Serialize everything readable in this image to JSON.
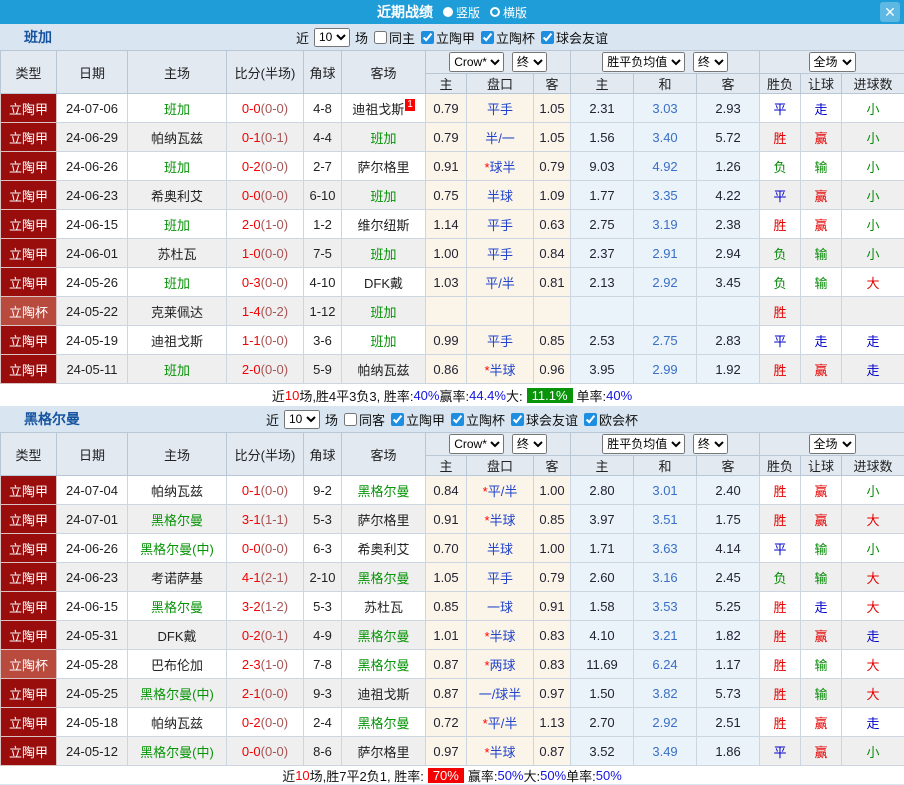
{
  "titlebar": {
    "title": "近期战绩",
    "vertical_label": "竖版",
    "horizontal_label": "横版",
    "vertical_selected": true,
    "close": "✕"
  },
  "colors": {
    "topbar": "#1f9dd9",
    "league_red": "#9a0d0d",
    "cup_red": "#b94a3e",
    "win_red": "#e60000",
    "draw_blue": "#0000cc",
    "lose_green": "#088a08",
    "odds_bg": "#fbf4e8",
    "avg_bg": "#eaf3fa"
  },
  "table_header": {
    "cols": [
      "类型",
      "日期",
      "主场",
      "比分(半场)",
      "角球",
      "客场"
    ],
    "dd_company": "Crow*",
    "dd_final": "终",
    "dd_avg": "胜平负均值",
    "dd_scope": "全场",
    "sub": [
      "主",
      "盘口",
      "客",
      "主",
      "和",
      "客",
      "胜负",
      "让球",
      "进球数"
    ]
  },
  "sections": [
    {
      "team": "班加",
      "filters": {
        "near": "近",
        "count": "10",
        "games": "场",
        "checks": [
          {
            "label": "同主",
            "on": false
          },
          {
            "label": "立陶甲",
            "on": true
          },
          {
            "label": "立陶杯",
            "on": true
          },
          {
            "label": "球会友谊",
            "on": true
          }
        ]
      },
      "rows": [
        {
          "lg": "立陶甲",
          "cup": false,
          "date": "24-07-06",
          "home": "班加",
          "hs": true,
          "score": "0-0",
          "half": "(0-0)",
          "corner": "4-8",
          "away": "迪祖戈斯",
          "as": false,
          "badge": "1",
          "o": [
            "0.79",
            "平手",
            "1.05"
          ],
          "avg": [
            "2.31",
            "3.03",
            "2.93"
          ],
          "r": [
            "平",
            "走",
            "小"
          ]
        },
        {
          "lg": "立陶甲",
          "cup": false,
          "date": "24-06-29",
          "home": "帕纳瓦兹",
          "hs": false,
          "score": "0-1",
          "half": "(0-1)",
          "corner": "4-4",
          "away": "班加",
          "as": true,
          "badge": "",
          "o": [
            "0.79",
            "半/一",
            "1.05"
          ],
          "avg": [
            "1.56",
            "3.40",
            "5.72"
          ],
          "r": [
            "胜",
            "赢",
            "小"
          ]
        },
        {
          "lg": "立陶甲",
          "cup": false,
          "date": "24-06-26",
          "home": "班加",
          "hs": true,
          "score": "0-2",
          "half": "(0-0)",
          "corner": "2-7",
          "away": "萨尔格里",
          "as": false,
          "badge": "",
          "o": [
            "0.91",
            "*球半",
            "0.79"
          ],
          "avg": [
            "9.03",
            "4.92",
            "1.26"
          ],
          "r": [
            "负",
            "输",
            "小"
          ]
        },
        {
          "lg": "立陶甲",
          "cup": false,
          "date": "24-06-23",
          "home": "希奥利艾",
          "hs": false,
          "score": "0-0",
          "half": "(0-0)",
          "corner": "6-10",
          "away": "班加",
          "as": true,
          "badge": "",
          "o": [
            "0.75",
            "半球",
            "1.09"
          ],
          "avg": [
            "1.77",
            "3.35",
            "4.22"
          ],
          "r": [
            "平",
            "赢",
            "小"
          ]
        },
        {
          "lg": "立陶甲",
          "cup": false,
          "date": "24-06-15",
          "home": "班加",
          "hs": true,
          "score": "2-0",
          "half": "(1-0)",
          "corner": "1-2",
          "away": "维尔纽斯",
          "as": false,
          "badge": "",
          "o": [
            "1.14",
            "平手",
            "0.63"
          ],
          "avg": [
            "2.75",
            "3.19",
            "2.38"
          ],
          "r": [
            "胜",
            "赢",
            "小"
          ]
        },
        {
          "lg": "立陶甲",
          "cup": false,
          "date": "24-06-01",
          "home": "苏杜瓦",
          "hs": false,
          "score": "1-0",
          "half": "(0-0)",
          "corner": "7-5",
          "away": "班加",
          "as": true,
          "badge": "",
          "o": [
            "1.00",
            "平手",
            "0.84"
          ],
          "avg": [
            "2.37",
            "2.91",
            "2.94"
          ],
          "r": [
            "负",
            "输",
            "小"
          ]
        },
        {
          "lg": "立陶甲",
          "cup": false,
          "date": "24-05-26",
          "home": "班加",
          "hs": true,
          "score": "0-3",
          "half": "(0-0)",
          "corner": "4-10",
          "away": "DFK戴",
          "as": false,
          "badge": "",
          "o": [
            "1.03",
            "平/半",
            "0.81"
          ],
          "avg": [
            "2.13",
            "2.92",
            "3.45"
          ],
          "r": [
            "负",
            "输",
            "大"
          ]
        },
        {
          "lg": "立陶杯",
          "cup": true,
          "date": "24-05-22",
          "home": "克莱佩达",
          "hs": false,
          "score": "1-4",
          "half": "(0-2)",
          "corner": "1-12",
          "away": "班加",
          "as": true,
          "badge": "",
          "o": [
            "",
            "",
            ""
          ],
          "avg": [
            "",
            "",
            ""
          ],
          "r": [
            "胜",
            "",
            ""
          ]
        },
        {
          "lg": "立陶甲",
          "cup": false,
          "date": "24-05-19",
          "home": "迪祖戈斯",
          "hs": false,
          "score": "1-1",
          "half": "(0-0)",
          "corner": "3-6",
          "away": "班加",
          "as": true,
          "badge": "",
          "o": [
            "0.99",
            "平手",
            "0.85"
          ],
          "avg": [
            "2.53",
            "2.75",
            "2.83"
          ],
          "r": [
            "平",
            "走",
            "走"
          ]
        },
        {
          "lg": "立陶甲",
          "cup": false,
          "date": "24-05-11",
          "home": "班加",
          "hs": true,
          "score": "2-0",
          "half": "(0-0)",
          "corner": "5-9",
          "away": "帕纳瓦兹",
          "as": false,
          "badge": "",
          "o": [
            "0.86",
            "*半球",
            "0.96"
          ],
          "avg": [
            "3.95",
            "2.99",
            "1.92"
          ],
          "r": [
            "胜",
            "赢",
            "走"
          ]
        }
      ],
      "summary": [
        {
          "t": "近",
          "s": "plain"
        },
        {
          "t": "10",
          "s": "red"
        },
        {
          "t": "场,胜4平3负3, 胜率:",
          "s": "plain"
        },
        {
          "t": "40%",
          "s": "blue"
        },
        {
          "t": " 赢率:",
          "s": "plain"
        },
        {
          "t": "44.4%",
          "s": "blue"
        },
        {
          "t": " 大:",
          "s": "plain"
        },
        {
          "t": "11.1%",
          "s": "greenbox"
        },
        {
          "t": " 单率:",
          "s": "plain"
        },
        {
          "t": "40%",
          "s": "blue"
        }
      ]
    },
    {
      "team": "黑格尔曼",
      "filters": {
        "near": "近",
        "count": "10",
        "games": "场",
        "checks": [
          {
            "label": "同客",
            "on": false
          },
          {
            "label": "立陶甲",
            "on": true
          },
          {
            "label": "立陶杯",
            "on": true
          },
          {
            "label": "球会友谊",
            "on": true
          },
          {
            "label": "欧会杯",
            "on": true
          }
        ]
      },
      "rows": [
        {
          "lg": "立陶甲",
          "cup": false,
          "date": "24-07-04",
          "home": "帕纳瓦兹",
          "hs": false,
          "score": "0-1",
          "half": "(0-0)",
          "corner": "9-2",
          "away": "黑格尔曼",
          "as": true,
          "badge": "",
          "o": [
            "0.84",
            "*平/半",
            "1.00"
          ],
          "avg": [
            "2.80",
            "3.01",
            "2.40"
          ],
          "r": [
            "胜",
            "赢",
            "小"
          ]
        },
        {
          "lg": "立陶甲",
          "cup": false,
          "date": "24-07-01",
          "home": "黑格尔曼",
          "hs": true,
          "score": "3-1",
          "half": "(1-1)",
          "corner": "5-3",
          "away": "萨尔格里",
          "as": false,
          "badge": "",
          "o": [
            "0.91",
            "*半球",
            "0.85"
          ],
          "avg": [
            "3.97",
            "3.51",
            "1.75"
          ],
          "r": [
            "胜",
            "赢",
            "大"
          ]
        },
        {
          "lg": "立陶甲",
          "cup": false,
          "date": "24-06-26",
          "home": "黑格尔曼(中)",
          "hs": true,
          "score": "0-0",
          "half": "(0-0)",
          "corner": "6-3",
          "away": "希奥利艾",
          "as": false,
          "badge": "",
          "o": [
            "0.70",
            "半球",
            "1.00"
          ],
          "avg": [
            "1.71",
            "3.63",
            "4.14"
          ],
          "r": [
            "平",
            "输",
            "小"
          ]
        },
        {
          "lg": "立陶甲",
          "cup": false,
          "date": "24-06-23",
          "home": "考诺萨基",
          "hs": false,
          "score": "4-1",
          "half": "(2-1)",
          "corner": "2-10",
          "away": "黑格尔曼",
          "as": true,
          "badge": "",
          "o": [
            "1.05",
            "平手",
            "0.79"
          ],
          "avg": [
            "2.60",
            "3.16",
            "2.45"
          ],
          "r": [
            "负",
            "输",
            "大"
          ]
        },
        {
          "lg": "立陶甲",
          "cup": false,
          "date": "24-06-15",
          "home": "黑格尔曼",
          "hs": true,
          "score": "3-2",
          "half": "(1-2)",
          "corner": "5-3",
          "away": "苏杜瓦",
          "as": false,
          "badge": "",
          "o": [
            "0.85",
            "一球",
            "0.91"
          ],
          "avg": [
            "1.58",
            "3.53",
            "5.25"
          ],
          "r": [
            "胜",
            "走",
            "大"
          ]
        },
        {
          "lg": "立陶甲",
          "cup": false,
          "date": "24-05-31",
          "home": "DFK戴",
          "hs": false,
          "score": "0-2",
          "half": "(0-1)",
          "corner": "4-9",
          "away": "黑格尔曼",
          "as": true,
          "badge": "",
          "o": [
            "1.01",
            "*半球",
            "0.83"
          ],
          "avg": [
            "4.10",
            "3.21",
            "1.82"
          ],
          "r": [
            "胜",
            "赢",
            "走"
          ]
        },
        {
          "lg": "立陶杯",
          "cup": true,
          "date": "24-05-28",
          "home": "巴布伦加",
          "hs": false,
          "score": "2-3",
          "half": "(1-0)",
          "corner": "7-8",
          "away": "黑格尔曼",
          "as": true,
          "badge": "",
          "o": [
            "0.87",
            "*两球",
            "0.83"
          ],
          "avg": [
            "11.69",
            "6.24",
            "1.17"
          ],
          "r": [
            "胜",
            "输",
            "大"
          ]
        },
        {
          "lg": "立陶甲",
          "cup": false,
          "date": "24-05-25",
          "home": "黑格尔曼(中)",
          "hs": true,
          "score": "2-1",
          "half": "(0-0)",
          "corner": "9-3",
          "away": "迪祖戈斯",
          "as": false,
          "badge": "",
          "o": [
            "0.87",
            "一/球半",
            "0.97"
          ],
          "avg": [
            "1.50",
            "3.82",
            "5.73"
          ],
          "r": [
            "胜",
            "输",
            "大"
          ]
        },
        {
          "lg": "立陶甲",
          "cup": false,
          "date": "24-05-18",
          "home": "帕纳瓦兹",
          "hs": false,
          "score": "0-2",
          "half": "(0-0)",
          "corner": "2-4",
          "away": "黑格尔曼",
          "as": true,
          "badge": "",
          "o": [
            "0.72",
            "*平/半",
            "1.13"
          ],
          "avg": [
            "2.70",
            "2.92",
            "2.51"
          ],
          "r": [
            "胜",
            "赢",
            "走"
          ]
        },
        {
          "lg": "立陶甲",
          "cup": false,
          "date": "24-05-12",
          "home": "黑格尔曼(中)",
          "hs": true,
          "score": "0-0",
          "half": "(0-0)",
          "corner": "8-6",
          "away": "萨尔格里",
          "as": false,
          "badge": "",
          "o": [
            "0.97",
            "*半球",
            "0.87"
          ],
          "avg": [
            "3.52",
            "3.49",
            "1.86"
          ],
          "r": [
            "平",
            "赢",
            "小"
          ]
        }
      ],
      "summary": [
        {
          "t": "近",
          "s": "plain"
        },
        {
          "t": "10",
          "s": "red"
        },
        {
          "t": "场,胜7平2负1, 胜率:",
          "s": "plain"
        },
        {
          "t": "70%",
          "s": "redbox"
        },
        {
          "t": " 赢率:",
          "s": "plain"
        },
        {
          "t": "50%",
          "s": "blue"
        },
        {
          "t": " 大:",
          "s": "plain"
        },
        {
          "t": "50%",
          "s": "blue"
        },
        {
          "t": " 单率:",
          "s": "plain"
        },
        {
          "t": "50%",
          "s": "blue"
        }
      ]
    }
  ]
}
